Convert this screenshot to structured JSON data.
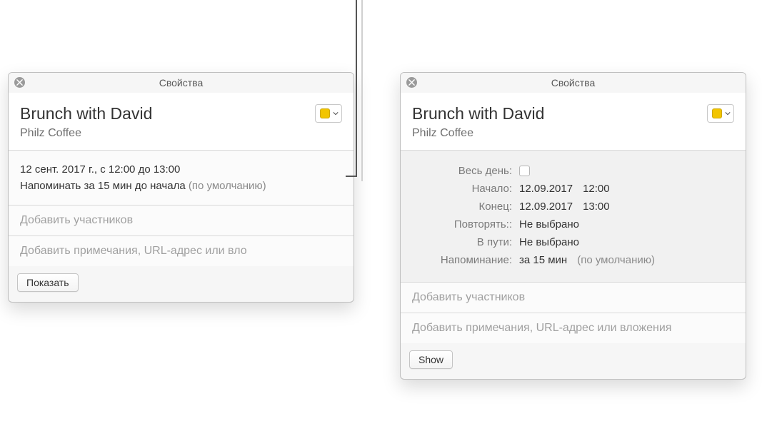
{
  "left": {
    "window_title": "Свойства",
    "event_title": "Brunch with David",
    "event_location": "Philz Coffee",
    "calendar_color": "#f2c500",
    "summary_line": "12 сент. 2017 г., с 12:00 до 13:00",
    "reminder_line": "Напоминать за 15 мин до начала",
    "reminder_suffix": "(по умолчанию)",
    "invitees_placeholder": "Добавить участников",
    "notes_placeholder": "Добавить примечания, URL-адрес или вло",
    "show_button": "Показать"
  },
  "right": {
    "window_title": "Свойства",
    "event_title": "Brunch with David",
    "event_location": "Philz Coffee",
    "calendar_color": "#f2c500",
    "labels": {
      "all_day": "Весь день:",
      "start": "Начало:",
      "end": "Конец:",
      "repeat": "Повторять::",
      "travel": "В пути:",
      "reminder": "Напоминание:"
    },
    "values": {
      "start_date": "12.09.2017",
      "start_time": "12:00",
      "end_date": "12.09.2017",
      "end_time": "13:00",
      "repeat": "Не выбрано",
      "travel": "Не выбрано",
      "reminder": "за 15 мин",
      "reminder_suffix": "(по умолчанию)"
    },
    "invitees_placeholder": "Добавить участников",
    "notes_placeholder": "Добавить примечания, URL-адрес или вложения",
    "show_button": "Show"
  }
}
